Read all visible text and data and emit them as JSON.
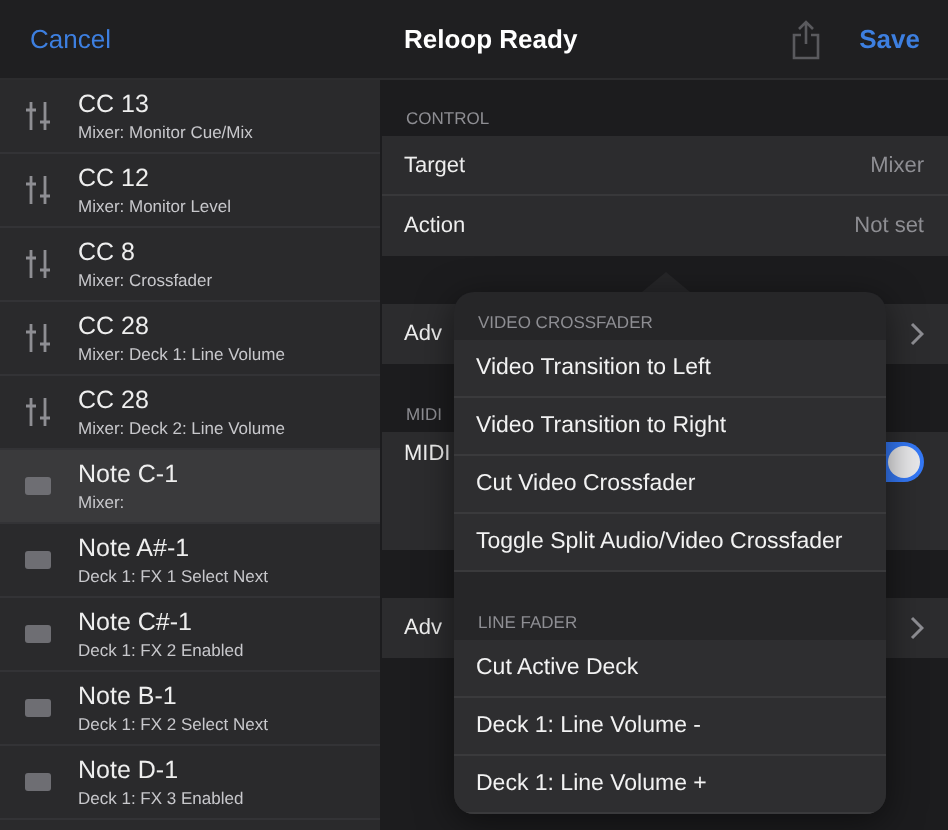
{
  "header": {
    "cancel": "Cancel",
    "title": "Reloop Ready",
    "save": "Save"
  },
  "list": [
    {
      "kind": "cc",
      "title": "CC 13",
      "subtitle": "Mixer: Monitor Cue/Mix",
      "selected": false
    },
    {
      "kind": "cc",
      "title": "CC 12",
      "subtitle": "Mixer: Monitor Level",
      "selected": false
    },
    {
      "kind": "cc",
      "title": "CC 8",
      "subtitle": "Mixer: Crossfader",
      "selected": false
    },
    {
      "kind": "cc",
      "title": "CC 28",
      "subtitle": "Mixer: Deck 1: Line Volume",
      "selected": false
    },
    {
      "kind": "cc",
      "title": "CC 28",
      "subtitle": "Mixer: Deck 2: Line Volume",
      "selected": false
    },
    {
      "kind": "note",
      "title": "Note C-1",
      "subtitle": "Mixer:",
      "selected": true
    },
    {
      "kind": "note",
      "title": "Note A#-1",
      "subtitle": "Deck 1: FX 1 Select Next",
      "selected": false
    },
    {
      "kind": "note",
      "title": "Note C#-1",
      "subtitle": "Deck 1: FX 2 Enabled",
      "selected": false
    },
    {
      "kind": "note",
      "title": "Note B-1",
      "subtitle": "Deck 1: FX 2 Select Next",
      "selected": false
    },
    {
      "kind": "note",
      "title": "Note D-1",
      "subtitle": "Deck 1: FX 3 Enabled",
      "selected": false
    }
  ],
  "detail": [
    {
      "header": "CONTROL",
      "rows": [
        {
          "kind": "value",
          "label": "Target",
          "value": "Mixer"
        },
        {
          "kind": "value",
          "label": "Action",
          "value": "Not set"
        }
      ]
    },
    {
      "rows": [
        {
          "kind": "link",
          "label": "Adv"
        }
      ]
    },
    {
      "header": "MIDI",
      "rows": [
        {
          "kind": "toggle",
          "label": "MIDI",
          "on": true
        }
      ]
    },
    {
      "rows": [
        {
          "kind": "link",
          "label": "Adv"
        }
      ]
    }
  ],
  "popover": [
    {
      "header": "VIDEO CROSSFADER",
      "items": [
        "Video Transition to Left",
        "Video Transition to Right",
        "Cut Video Crossfader",
        "Toggle Split Audio/Video Crossfader"
      ]
    },
    {
      "header": "LINE FADER",
      "items": [
        "Cut Active Deck",
        "Deck 1: Line Volume -",
        "Deck 1: Line Volume +"
      ]
    }
  ]
}
